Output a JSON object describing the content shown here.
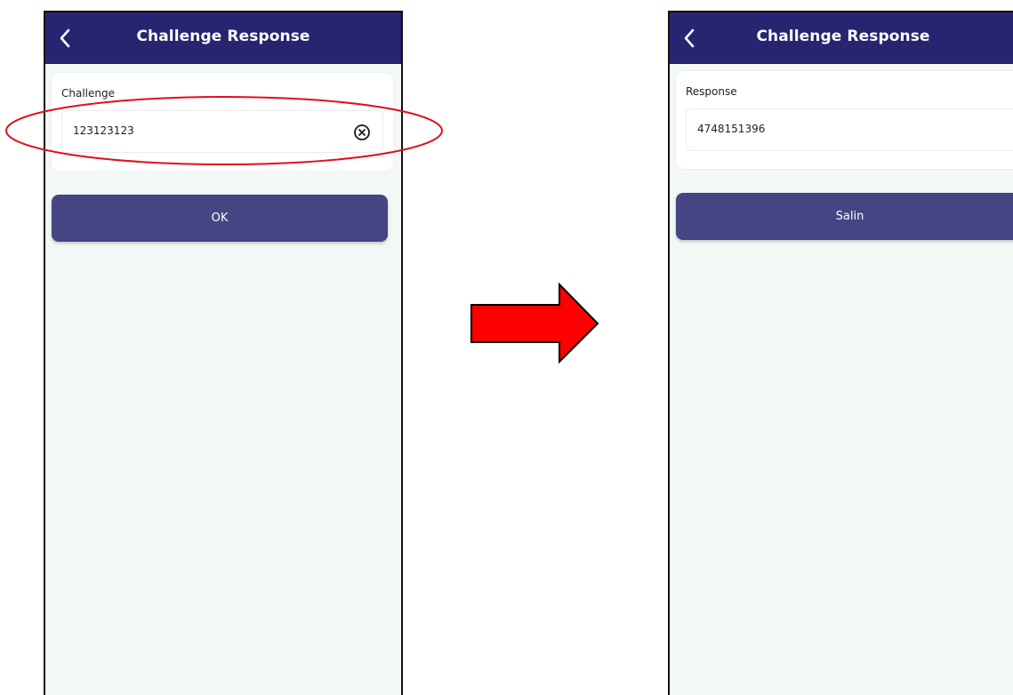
{
  "left_screen": {
    "appbar": {
      "title": "Challenge Response"
    },
    "card": {
      "label": "Challenge"
    },
    "input": {
      "value": "123123123"
    },
    "button": {
      "label": "OK"
    }
  },
  "right_screen": {
    "appbar": {
      "title": "Challenge Response"
    },
    "card": {
      "label": "Response"
    },
    "input": {
      "value": "4748151396"
    },
    "button": {
      "label": "Salin"
    }
  },
  "annotations": {
    "highlight_color": "#e0101a",
    "arrow_fill": "#ff0000",
    "arrow_stroke": "#000000"
  },
  "colors": {
    "appbar": "#272570",
    "button": "#454584",
    "background": "#f3f8f7"
  },
  "icons": [
    "back-chevron-icon",
    "clear-circle-x-icon"
  ]
}
